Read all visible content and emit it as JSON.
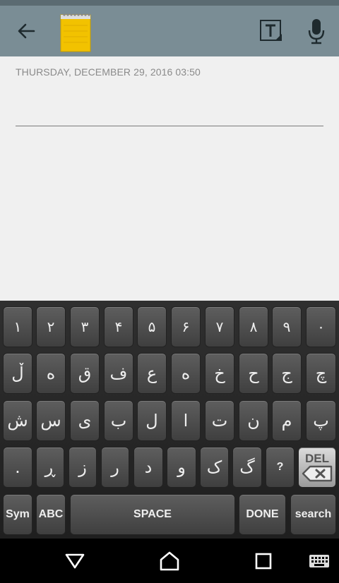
{
  "toolbar": {
    "back_icon": "arrow-left-icon",
    "app_icon": "notepad-icon",
    "text_tool_icon": "text-format-icon",
    "mic_icon": "microphone-icon"
  },
  "note": {
    "date": "THURSDAY, DECEMBER 29, 2016 03:50"
  },
  "keyboard": {
    "row1": [
      "١",
      "٢",
      "٣",
      "۴",
      "۵",
      "۶",
      "٧",
      "٨",
      "٩",
      "٠"
    ],
    "row2": [
      "ڵ",
      "ە",
      "ق",
      "ف",
      "ع",
      "ه",
      "خ",
      "ح",
      "ج",
      "چ"
    ],
    "row3": [
      "ش",
      "س",
      "ی",
      "ب",
      "ل",
      "ا",
      "ت",
      "ن",
      "م",
      "پ"
    ],
    "row4": [
      ".",
      "ڕ",
      "ز",
      "ر",
      "د",
      "و",
      "ک",
      "گ",
      "?"
    ],
    "del_label": "DEL",
    "sym_label": "Sym",
    "abc_label": "ABC",
    "space_label": "SPACE",
    "done_label": "DONE",
    "search_label": "search"
  },
  "navbar": {
    "back_icon": "triangle-back-icon",
    "home_icon": "home-icon",
    "recents_icon": "square-recents-icon",
    "keyboard_icon": "keyboard-icon"
  },
  "colors": {
    "toolbar": "#7a8d95",
    "note_bg": "#f0f0f0",
    "key": "#4e4e4e",
    "del_key": "#c8c8c8"
  }
}
